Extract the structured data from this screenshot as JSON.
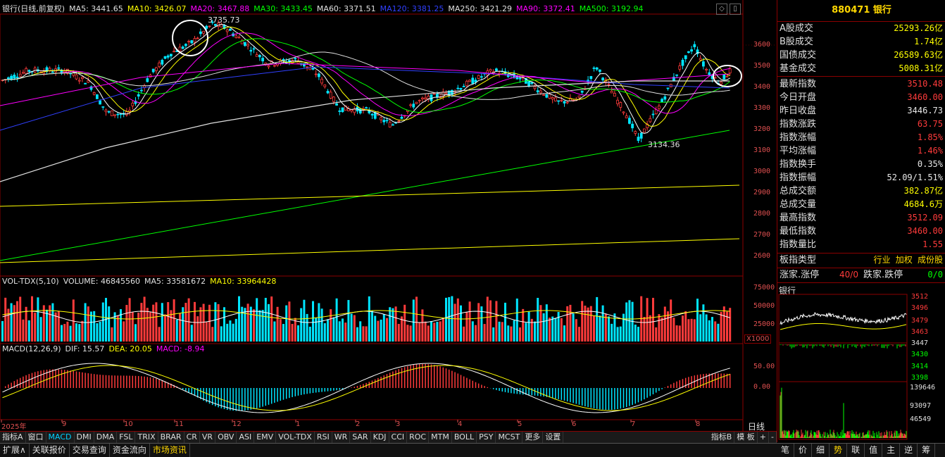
{
  "main_chart": {
    "header_items": [
      {
        "text": "银行(日线,前复权)",
        "color": "#e0e0e0"
      },
      {
        "text": "MA5: 3441.65",
        "color": "#e0e0e0"
      },
      {
        "text": "MA10: 3426.07",
        "color": "#ffff00"
      },
      {
        "text": "MA20: 3467.88",
        "color": "#ff00ff"
      },
      {
        "text": "MA30: 3433.45",
        "color": "#00ff00"
      },
      {
        "text": "MA60: 3371.51",
        "color": "#e0e0e0"
      },
      {
        "text": "MA120: 3381.25",
        "color": "#3040ff"
      },
      {
        "text": "MA250: 3421.29",
        "color": "#e0e0e0"
      },
      {
        "text": "MA90: 3372.41",
        "color": "#ff00ff"
      },
      {
        "text": "MA500: 3192.94",
        "color": "#00ff00"
      }
    ],
    "high_label": "3735.73",
    "low_label": "3134.36",
    "y_ticks": [
      "3600",
      "3500",
      "3400",
      "3300",
      "3200",
      "3100",
      "3000",
      "2900",
      "2800",
      "2700",
      "2600"
    ]
  },
  "volume_chart": {
    "header_items": [
      {
        "text": "VOL-TDX(5,10)",
        "color": "#e0e0e0"
      },
      {
        "text": "VOLUME: 46845560",
        "color": "#e0e0e0"
      },
      {
        "text": "MA5: 33581672",
        "color": "#e0e0e0"
      },
      {
        "text": "MA10: 33964428",
        "color": "#ffff00"
      }
    ],
    "y_ticks": [
      "75000",
      "50000",
      "25000"
    ],
    "unit": "X1000"
  },
  "macd_chart": {
    "header_items": [
      {
        "text": "MACD(12,26,9)",
        "color": "#e0e0e0"
      },
      {
        "text": "DIF: 15.57",
        "color": "#e0e0e0"
      },
      {
        "text": "DEA: 20.05",
        "color": "#ffff00"
      },
      {
        "text": "MACD: -8.94",
        "color": "#ff00ff"
      }
    ],
    "y_ticks": [
      "50.00",
      "0.00"
    ]
  },
  "x_axis_labels": [
    "2025年",
    "9",
    "10",
    "11",
    "12",
    "1",
    "2",
    "3",
    "4",
    "5",
    "6",
    "7",
    "8"
  ],
  "period_label": "日线",
  "right_panel": {
    "title": "880471 银行",
    "rows": [
      {
        "label": "A股成交",
        "value": "25293.26亿",
        "color": "#ffff00"
      },
      {
        "label": "B股成交",
        "value": "1.74亿",
        "color": "#ffff00"
      },
      {
        "label": "国债成交",
        "value": "26589.63亿",
        "color": "#ffff00"
      },
      {
        "label": "基金成交",
        "value": "5008.31亿",
        "color": "#ffff00"
      },
      {
        "label": "最新指数",
        "value": "3510.48",
        "color": "#ff3b3b"
      },
      {
        "label": "今日开盘",
        "value": "3460.00",
        "color": "#ff3b3b"
      },
      {
        "label": "昨日收盘",
        "value": "3446.73",
        "color": "#e8e8e8"
      },
      {
        "label": "指数涨跌",
        "value": "63.75",
        "color": "#ff3b3b"
      },
      {
        "label": "指数涨幅",
        "value": "1.85%",
        "color": "#ff3b3b"
      },
      {
        "label": "平均涨幅",
        "value": "1.46%",
        "color": "#ff3b3b"
      },
      {
        "label": "指数换手",
        "value": "0.35%",
        "color": "#e8e8e8"
      },
      {
        "label": "指数振幅",
        "value": "52.09/1.51%",
        "color": "#e8e8e8"
      },
      {
        "label": "总成交额",
        "value": "382.87亿",
        "color": "#ffff00"
      },
      {
        "label": "总成交量",
        "value": "4684.6万",
        "color": "#ffff00"
      },
      {
        "label": "最高指数",
        "value": "3512.09",
        "color": "#ff3b3b"
      },
      {
        "label": "最低指数",
        "value": "3460.00",
        "color": "#ff3b3b"
      },
      {
        "label": "指数量比",
        "value": "1.55",
        "color": "#ff3b3b"
      }
    ],
    "type_label": "板指类型",
    "type_value": "行业 加权 成份股",
    "up_label": "涨家.涨停",
    "up_value": "40/0",
    "down_label": "跌家.跌停",
    "down_value": "0/0",
    "mini_title": "银行",
    "mini_ticks": [
      "3512",
      "3496",
      "3479",
      "3463",
      "3447",
      "3430",
      "3414",
      "3398"
    ],
    "mini_vol_ticks": [
      "139646",
      "93097",
      "46549"
    ]
  },
  "indicator_tabs": [
    "指标A",
    "窗口",
    "MACD",
    "DMI",
    "DMA",
    "FSL",
    "TRIX",
    "BRAR",
    "CR",
    "VR",
    "OBV",
    "ASI",
    "EMV",
    "VOL-TDX",
    "RSI",
    "WR",
    "SAR",
    "KDJ",
    "CCI",
    "ROC",
    "MTM",
    "BOLL",
    "PSY",
    "MCST",
    "更多",
    "设置"
  ],
  "indicator_tabs_right": [
    "指标B",
    "模 板",
    "+",
    "-"
  ],
  "bottom_tabs": [
    "扩展∧",
    "关联报价",
    "交易查询",
    "资金流向",
    "市场资讯"
  ],
  "bottom_right_tabs": [
    "笔",
    "价",
    "细",
    "势",
    "联",
    "值",
    "主",
    "逆",
    "筹"
  ]
}
